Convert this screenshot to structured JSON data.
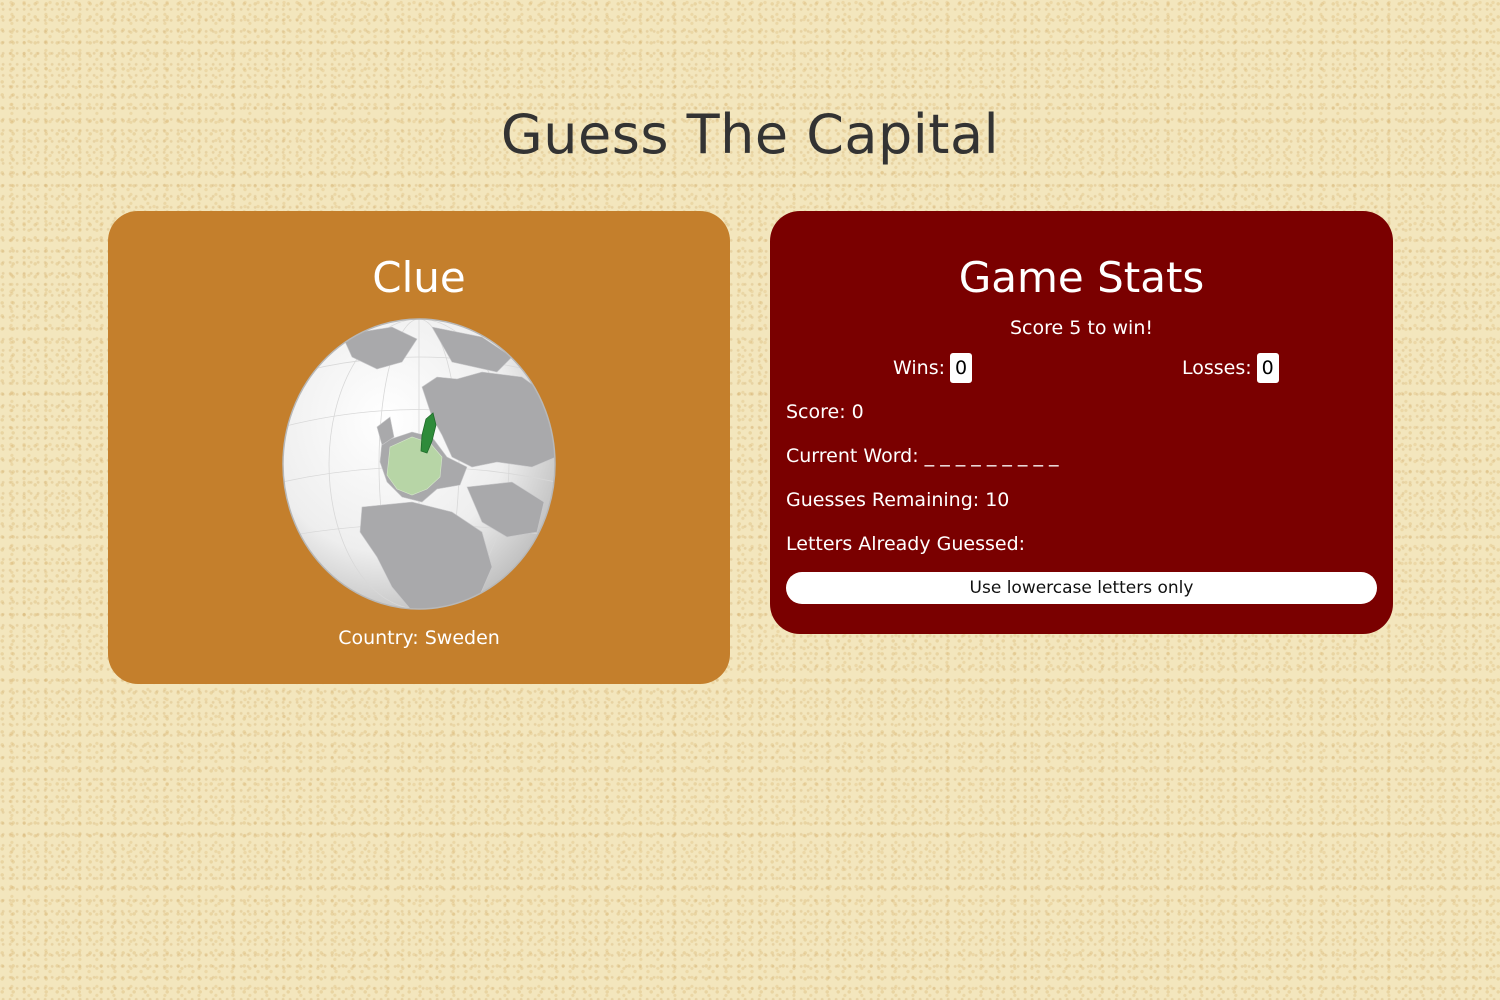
{
  "page": {
    "title": "Guess The Capital",
    "background_color": "#f3e6bd"
  },
  "clue": {
    "title": "Clue",
    "country_label": "Country: Sweden",
    "globe_icon": "globe-map-icon",
    "card_color": "#c47f2c",
    "highlight_color": "#2e8b3a"
  },
  "stats": {
    "title": "Game Stats",
    "win_message": "Score 5 to win!",
    "wins_label": "Wins:",
    "wins_value": "0",
    "losses_label": "Losses:",
    "losses_value": "0",
    "score": "Score: 0",
    "current_word": "Current Word: _ _ _ _ _ _ _ _ _",
    "guesses_remaining": "Guesses Remaining: 10",
    "letters_guessed": "Letters Already Guessed:",
    "hint_button": "Use lowercase letters only",
    "card_color": "#7a0000"
  }
}
